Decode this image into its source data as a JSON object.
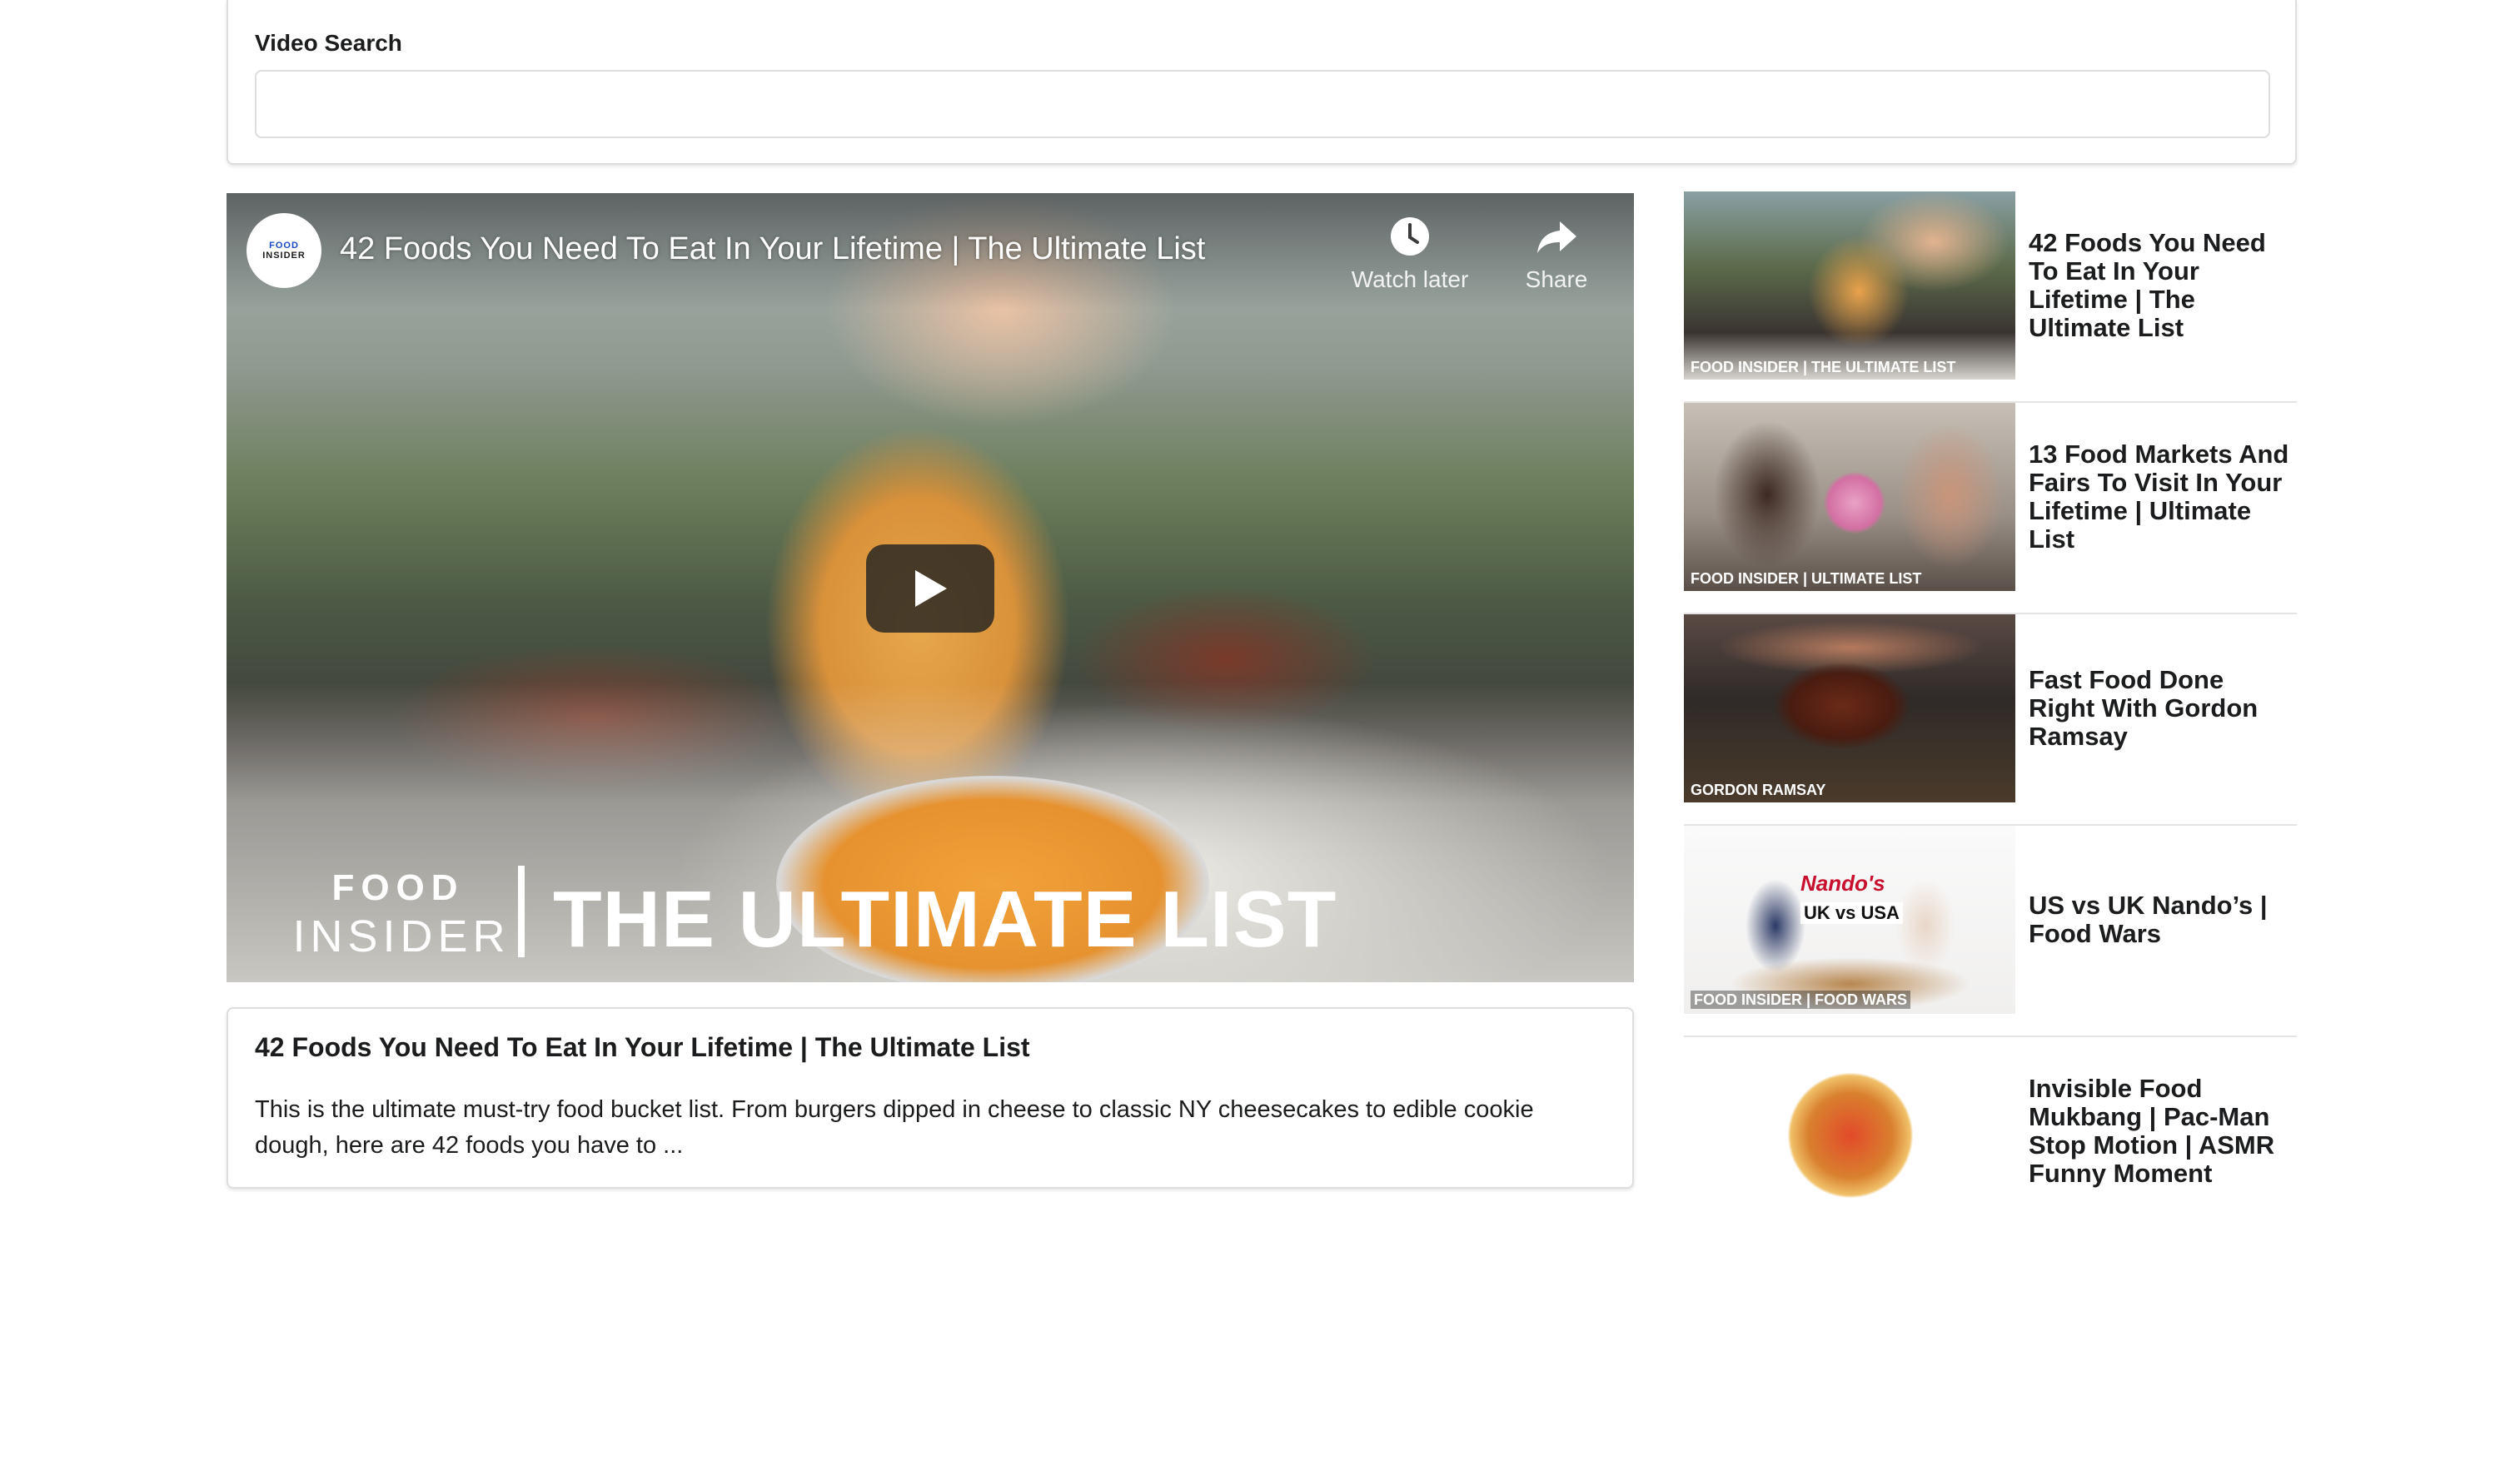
{
  "search": {
    "label": "Video Search",
    "value": "",
    "placeholder": ""
  },
  "player": {
    "channel_logo_top": "FOOD",
    "channel_logo_bottom": "INSIDER",
    "title": "42 Foods You Need To Eat In Your Lifetime | The Ultimate List",
    "watch_later_label": "Watch later",
    "share_label": "Share",
    "overlay_brand_top": "FOOD",
    "overlay_brand_bottom": "INSIDER",
    "overlay_caption": "THE ULTIMATE LIST",
    "icons": [
      "clock-icon",
      "share-icon",
      "play-icon"
    ]
  },
  "details": {
    "title": "42 Foods You Need To Eat In Your Lifetime | The Ultimate List",
    "description": "This is the ultimate must-try food bucket list. From burgers dipped in cheese to classic NY cheesecakes to edible cookie dough, here are 42 foods you have to ..."
  },
  "video_list": [
    {
      "title": "42 Foods You Need To Eat In Your Lifetime | The Ultimate List",
      "thumb_caption": "FOOD INSIDER | THE ULTIMATE LIST"
    },
    {
      "title": "13 Food Markets And Fairs To Visit In Your Lifetime | Ultimate List",
      "thumb_caption": "FOOD INSIDER | ULTIMATE LIST"
    },
    {
      "title": "Fast Food Done Right With Gordon Ramsay",
      "thumb_caption": "GORDON RAMSAY"
    },
    {
      "title": "US vs UK Nando’s | Food Wars",
      "thumb_caption": "FOOD INSIDER | FOOD WARS",
      "thumb_brand": "Nando's",
      "thumb_badge": "UK vs USA"
    },
    {
      "title": "Invisible Food Mukbang | Pac-Man Stop Motion | ASMR Funny Moment",
      "thumb_caption": ""
    }
  ],
  "colors": {
    "border": "#dededf",
    "text": "#1b1c1d",
    "nandos_red": "#c8102e"
  }
}
